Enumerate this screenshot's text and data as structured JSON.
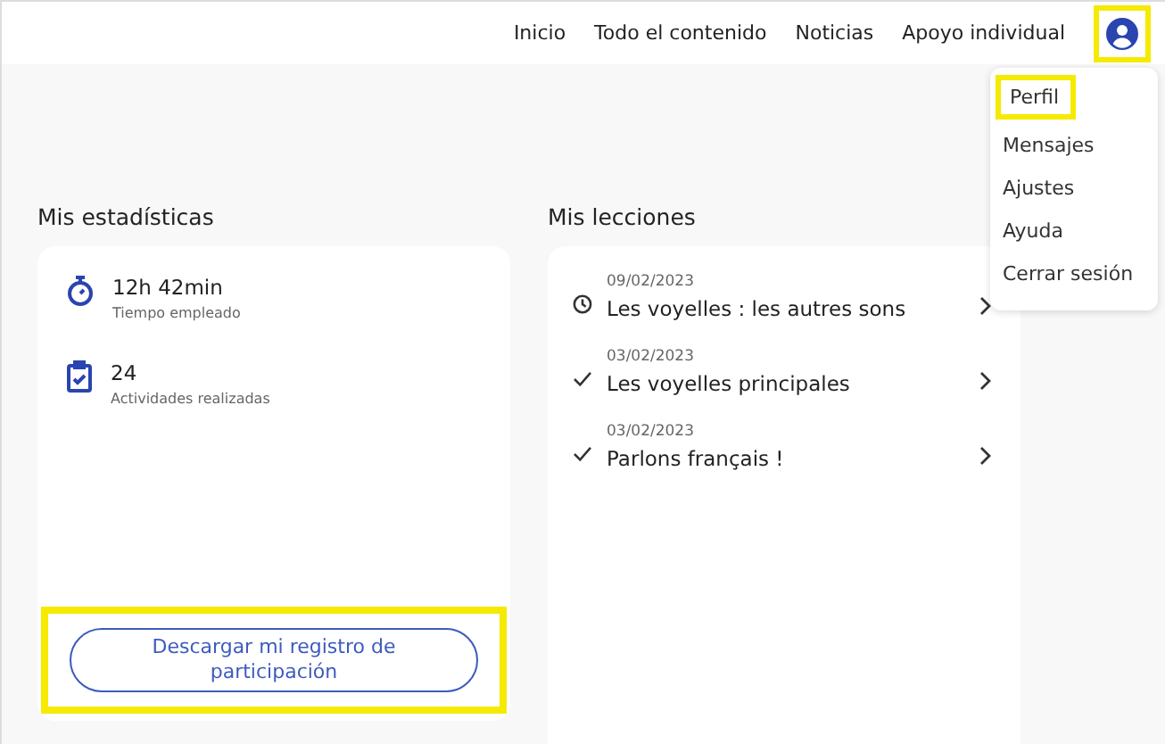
{
  "nav": {
    "links": [
      {
        "label": "Inicio"
      },
      {
        "label": "Todo el contenido"
      },
      {
        "label": "Noticias"
      },
      {
        "label": "Apoyo individual"
      }
    ],
    "profile_highlighted": true
  },
  "user_menu": {
    "items": [
      {
        "label": "Perfil",
        "highlighted": true
      },
      {
        "label": "Mensajes",
        "highlighted": false
      },
      {
        "label": "Ajustes",
        "highlighted": false
      },
      {
        "label": "Ayuda",
        "highlighted": false
      },
      {
        "label": "Cerrar sesión",
        "highlighted": false
      }
    ]
  },
  "stats": {
    "title": "Mis estadísticas",
    "items": [
      {
        "kind": "time",
        "value": "12h 42min",
        "label": "Tiempo empleado"
      },
      {
        "kind": "activities",
        "value": "24",
        "label": "Actividades realizadas"
      }
    ],
    "download_button": {
      "label": "Descargar mi registro de participación",
      "highlighted": true
    }
  },
  "lessons": {
    "title": "Mis lecciones",
    "items": [
      {
        "date": "09/02/2023",
        "title": "Les voyelles : les autres sons",
        "kind": "in_progress"
      },
      {
        "date": "03/02/2023",
        "title": "Les voyelles principales",
        "kind": "done"
      },
      {
        "date": "03/02/2023",
        "title": "Parlons français !",
        "kind": "done"
      }
    ]
  }
}
